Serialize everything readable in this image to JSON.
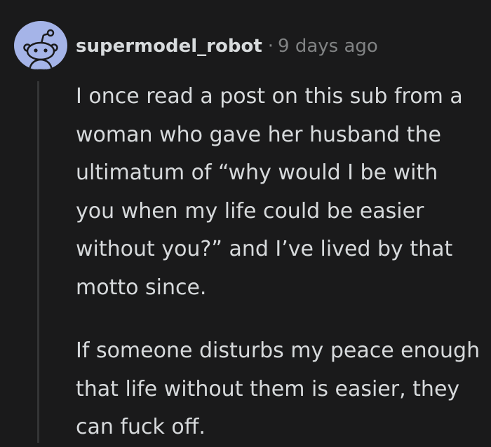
{
  "comment": {
    "author": "supermodel_robot",
    "separator": "·",
    "timestamp": "9 days ago",
    "avatar_icon": "snoo-avatar-icon",
    "colors": {
      "background": "#1a1a1b",
      "text": "#d7dadc",
      "muted": "#818384",
      "avatar_bg": "#a5b4e8",
      "thread_line": "#343536"
    },
    "paragraphs": [
      "I once read a post on this sub from a woman who gave her husband the ultimatum of “why would I be with you when my life could be easier without you?” and I’ve lived by that motto since.",
      "If someone disturbs my peace enough that life without them is easier, they can fuck off."
    ]
  }
}
